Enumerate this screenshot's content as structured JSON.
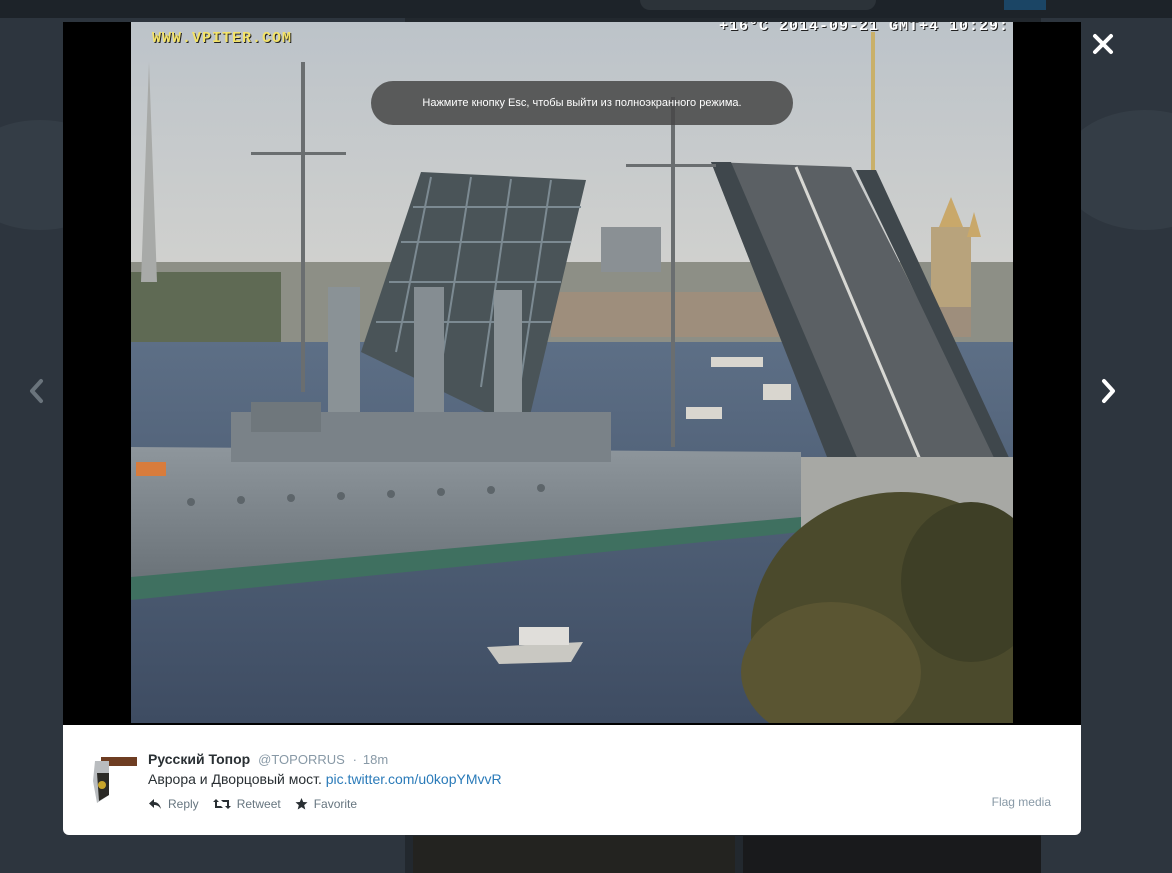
{
  "media": {
    "watermark_left": "WWW.VPITER.COM",
    "watermark_right": "+16°C 2014-09-21 GMT+4 10:29:",
    "fullscreen_notice": "Нажмите кнопку Esc, чтобы выйти из полноэкранного режима."
  },
  "tweet": {
    "name": "Русский Топор",
    "handle": "@TOPORRUS",
    "separator": "·",
    "time": "18m",
    "text": "Аврора и Дворцовый мост. ",
    "link": "pic.twitter.com/u0kopYMvvR"
  },
  "actions": {
    "reply": "Reply",
    "retweet": "Retweet",
    "favorite": "Favorite",
    "flag": "Flag media"
  },
  "icons": {
    "close": "close-icon",
    "prev": "chevron-left-icon",
    "next": "chevron-right-icon"
  },
  "colors": {
    "link": "#2b7bb9",
    "muted": "#8899a6",
    "text": "#292f33"
  }
}
